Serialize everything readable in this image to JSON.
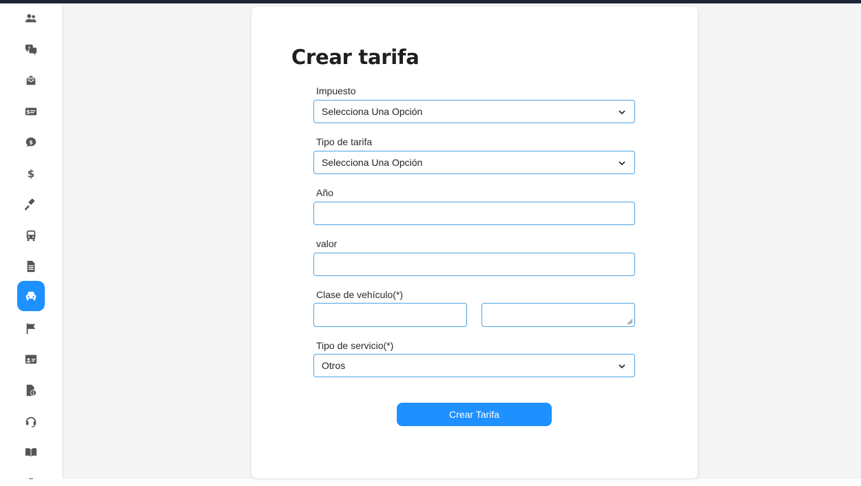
{
  "sidebar": {
    "items": [
      {
        "icon": "users-icon"
      },
      {
        "icon": "comments-question-icon"
      },
      {
        "icon": "inbox-icon"
      },
      {
        "icon": "money-check-icon"
      },
      {
        "icon": "comment-dollar-icon"
      },
      {
        "icon": "dollar-icon"
      },
      {
        "icon": "gavel-icon"
      },
      {
        "icon": "bus-icon"
      },
      {
        "icon": "file-lines-icon"
      },
      {
        "icon": "car-icon",
        "active": true
      },
      {
        "icon": "flag-icon"
      },
      {
        "icon": "id-card-icon"
      },
      {
        "icon": "file-info-icon"
      },
      {
        "icon": "headset-icon"
      },
      {
        "icon": "book-open-icon"
      },
      {
        "icon": "briefcase-icon"
      }
    ],
    "active_color": "#1e90ff",
    "icon_color": "#555555"
  },
  "form": {
    "title": "Crear tarifa",
    "impuesto": {
      "label": "Impuesto",
      "value": "Selecciona Una Opción"
    },
    "tipo_tarifa": {
      "label": "Tipo de tarifa",
      "value": "Selecciona Una Opción"
    },
    "anio": {
      "label": "Año",
      "value": ""
    },
    "valor": {
      "label": "valor",
      "value": ""
    },
    "clase_vehiculo": {
      "label": "Clase de vehículo(*)",
      "value_a": "",
      "value_b": ""
    },
    "tipo_servicio": {
      "label": "Tipo de servicio(*)",
      "value": "Otros"
    },
    "submit_label": "Crear Tarifa"
  },
  "colors": {
    "accent": "#1e90ff",
    "field_border": "#4aa3df",
    "topbar": "#1c2537"
  }
}
